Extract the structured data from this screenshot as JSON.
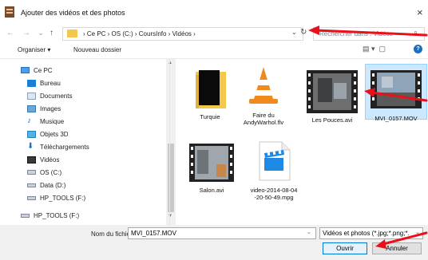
{
  "window": {
    "title": "Ajouter des vidéos et des photos",
    "close_glyph": "×"
  },
  "address": {
    "back_glyph": "←",
    "forward_glyph": "→",
    "up_glyph": "↑",
    "breadcrumb": "›  Ce PC  ›  OS (C:)  ›  CoursInfo  ›  Vidéos  ›",
    "dropdown_glyph": "⌄",
    "refresh_glyph": "↻",
    "search_placeholder": "Rechercher dans : Vidéos"
  },
  "toolbar": {
    "organiser": "Organiser ▾",
    "new_folder": "Nouveau dossier",
    "help": "?"
  },
  "sidebar": {
    "items": [
      {
        "label": "Ce PC",
        "icon": "computer-icon"
      },
      {
        "label": "Bureau",
        "icon": "desktop-icon"
      },
      {
        "label": "Documents",
        "icon": "documents-icon"
      },
      {
        "label": "Images",
        "icon": "images-icon"
      },
      {
        "label": "Musique",
        "icon": "music-icon"
      },
      {
        "label": "Objets 3D",
        "icon": "objects3d-icon"
      },
      {
        "label": "Téléchargements",
        "icon": "download-icon"
      },
      {
        "label": "Vidéos",
        "icon": "videos-icon"
      },
      {
        "label": "OS (C:)",
        "icon": "drive-icon"
      },
      {
        "label": "Data (D:)",
        "icon": "drive-icon"
      },
      {
        "label": "HP_TOOLS (F:)",
        "icon": "drive-icon"
      },
      {
        "label": "HP_TOOLS (F:)",
        "icon": "drive-icon"
      }
    ]
  },
  "files": [
    {
      "name": "Turquie",
      "type": "folder"
    },
    {
      "name": "Faire du AndyWarhol.flv",
      "type": "vlc"
    },
    {
      "name": "Les Pouces.avi",
      "type": "video"
    },
    {
      "name": "MVI_0157.MOV",
      "type": "video",
      "selected": true
    },
    {
      "name": "Salon.avi",
      "type": "video"
    },
    {
      "name": "video-2014-08-04 -20-50-49.mpg",
      "type": "clapper"
    }
  ],
  "bottom": {
    "filename_label": "Nom du fichier :",
    "filename_value": "MVI_0157.MOV",
    "filter_value": "Vidéos et photos (*.jpg;*.png;*.",
    "open_label": "Ouvrir",
    "cancel_label": "Annuler"
  },
  "colors": {
    "accent": "#0078d7",
    "selection": "#cce8ff",
    "arrow": "#e8111b",
    "folder": "#f3c64c"
  }
}
